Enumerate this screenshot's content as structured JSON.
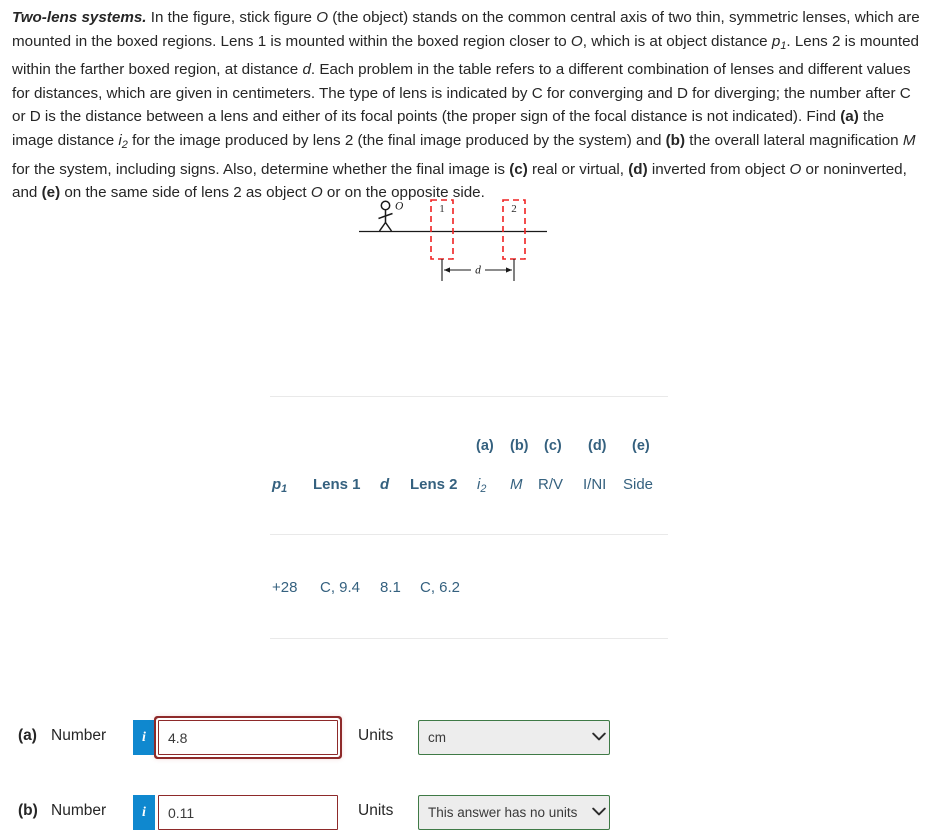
{
  "problem": {
    "title": "Two-lens systems.",
    "body_part1": " In the figure, stick figure ",
    "obj_symbol_1": "O",
    "body_part2": " (the object) stands on the common central axis of two thin, symmetric lenses, which are mounted in the boxed regions. Lens 1 is mounted within the boxed region closer to ",
    "obj_symbol_2": "O",
    "body_part3": ", which is at object distance ",
    "p1_var": "p",
    "p1_sub": "1",
    "body_part4": ". Lens 2 is mounted within the farther boxed region, at distance ",
    "d_var": "d",
    "body_part5": ". Each problem in the table refers to a different combination of lenses and different values for distances, which are given in centimeters. The type of lens is indicated by C for converging and D for diverging; the number after C or D is the distance between a lens and either of its focal points (the proper sign of the focal distance is not indicated). Find ",
    "label_a": "(a)",
    "body_part6": " the image distance ",
    "i2_var": "i",
    "i2_sub": "2",
    "body_part7": " for the image produced by lens 2 (the final image produced by the system) and ",
    "label_b": "(b)",
    "body_part8": " the overall lateral magnification ",
    "M_var": "M",
    "body_part9": " for the system, including signs. Also, determine whether the final image is ",
    "label_c": "(c)",
    "body_part10": " real or virtual, ",
    "label_d": "(d)",
    "body_part11": " inverted from object ",
    "obj_symbol_3": "O",
    "body_part12": " or noninverted, and ",
    "label_e": "(e)",
    "body_part13": " on the same side of lens 2 as object ",
    "obj_symbol_4": "O",
    "body_part14": " or on the opposite side."
  },
  "figure": {
    "object_label": "O",
    "lens1_label": "1",
    "lens2_label": "2",
    "distance_label": "d",
    "box_color": "#ee2222",
    "axis_color": "#1a1a1a"
  },
  "table": {
    "group_headers": [
      "(a)",
      "(b)",
      "(c)",
      "(d)",
      "(e)"
    ],
    "columns": [
      {
        "label": "p",
        "sub": "1",
        "italic": true,
        "bold": true
      },
      {
        "label": "Lens 1",
        "bold": true
      },
      {
        "label": "d",
        "italic": true,
        "bold": true
      },
      {
        "label": "Lens 2",
        "bold": true
      },
      {
        "label": "i",
        "sub": "2",
        "italic": true
      },
      {
        "label": "M",
        "italic": true
      },
      {
        "label": "R/V"
      },
      {
        "label": "I/NI"
      },
      {
        "label": "Side"
      }
    ],
    "rows": [
      {
        "p1": "+28",
        "lens1": "C, 9.4",
        "d": "8.1",
        "lens2": "C, 6.2",
        "i2": "",
        "M": "",
        "rv": "",
        "ini": "",
        "side": ""
      }
    ],
    "header_color": "#35617f"
  },
  "answers": [
    {
      "letter": "(a)",
      "number_label": "Number",
      "info_icon": "info-icon",
      "value": "4.8",
      "placeholder": "",
      "units_label": "Units",
      "unit_selected": "cm",
      "unit_options": [
        "cm"
      ],
      "focused": true
    },
    {
      "letter": "(b)",
      "number_label": "Number",
      "info_icon": "info-icon",
      "value": "0.11",
      "placeholder": "",
      "units_label": "Units",
      "unit_selected": "This answer has no units",
      "unit_options": [
        "This answer has no units"
      ],
      "focused": false
    }
  ],
  "colors": {
    "accent_blue": "#0f88cf",
    "input_border": "#8e2a2a",
    "select_border": "#3f7a46",
    "select_bg": "#ededed",
    "table_text": "#35617f",
    "rule": "#e9e9e9"
  }
}
